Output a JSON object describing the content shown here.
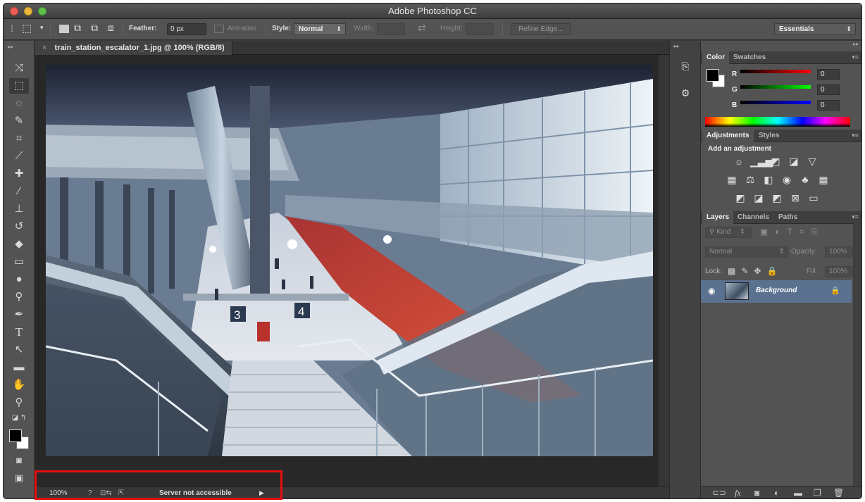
{
  "window": {
    "title": "Adobe Photoshop CC"
  },
  "options_bar": {
    "feather_label": "Feather:",
    "feather_value": "0 px",
    "antialias_label": "Anti-alias",
    "style_label": "Style:",
    "style_value": "Normal",
    "width_label": "Width:",
    "height_label": "Height:",
    "refine_edge_label": "Refine Edge...",
    "workspace_value": "Essentials"
  },
  "document": {
    "tab_title": "train_station_escalator_1.jpg @ 100% (RGB/8)",
    "sign_left": "3",
    "sign_right": "4"
  },
  "status_bar": {
    "zoom": "100%",
    "message": "Server not accessible"
  },
  "color_panel": {
    "tabs": [
      "Color",
      "Swatches"
    ],
    "r_label": "R",
    "g_label": "G",
    "b_label": "B",
    "r_value": "0",
    "g_value": "0",
    "b_value": "0"
  },
  "adjustments_panel": {
    "tabs": [
      "Adjustments",
      "Styles"
    ],
    "heading": "Add an adjustment"
  },
  "layers_panel": {
    "tabs": [
      "Layers",
      "Channels",
      "Paths"
    ],
    "kind_filter": "Kind",
    "blend_mode": "Normal",
    "opacity_label": "Opacity:",
    "opacity_value": "100%",
    "lock_label": "Lock:",
    "fill_label": "Fill:",
    "fill_value": "100%",
    "layers": [
      {
        "name": "Background",
        "visible": true,
        "locked": true
      }
    ]
  },
  "colors": {
    "highlight_box": "#e60f0f",
    "selected_layer": "#5b7190",
    "foreground": "#000000",
    "background": "#ffffff"
  }
}
